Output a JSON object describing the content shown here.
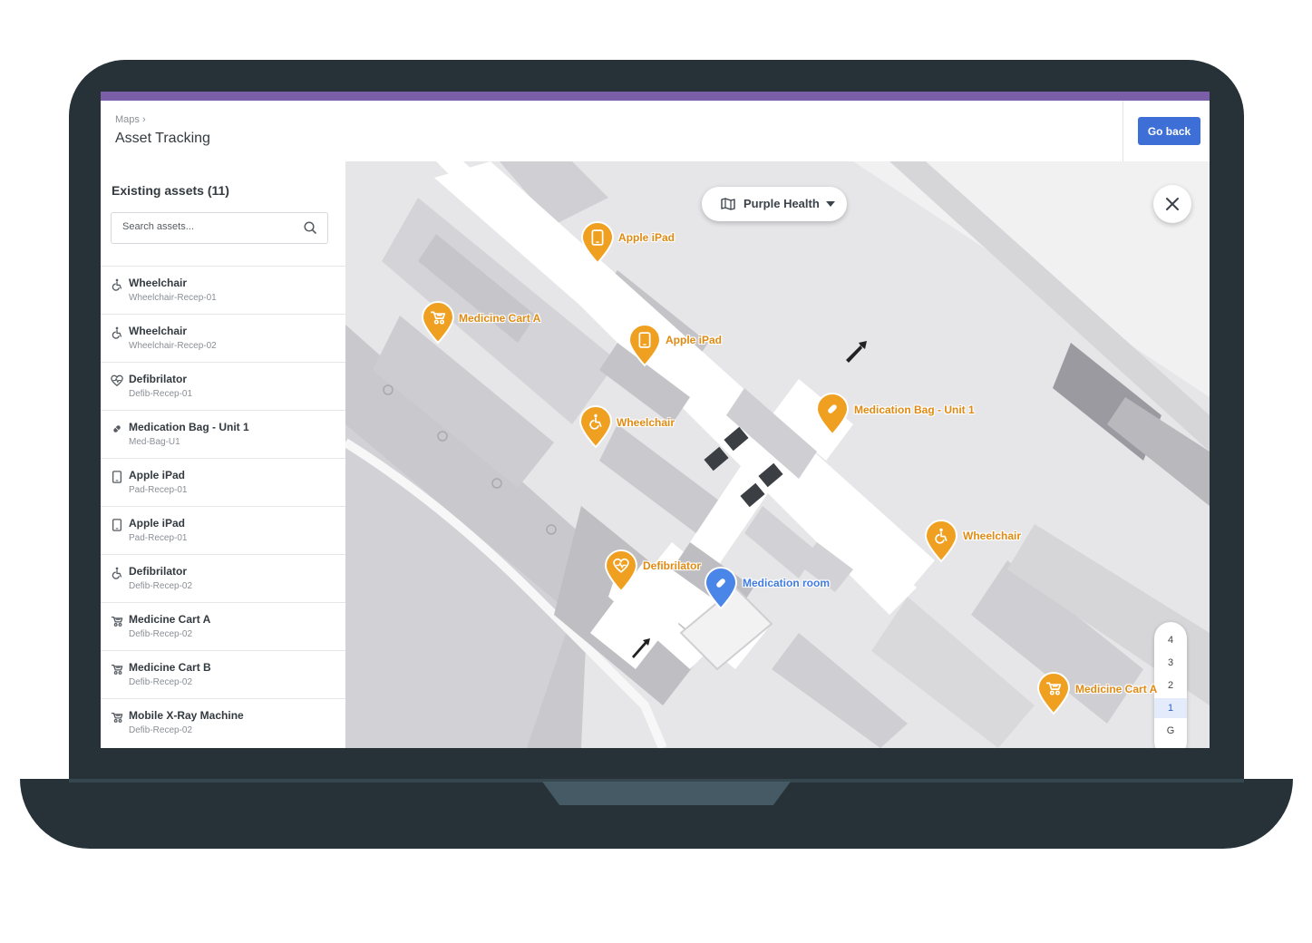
{
  "header": {
    "breadcrumb": "Maps ›",
    "title": "Asset Tracking",
    "go_back_label": "Go back"
  },
  "sidebar": {
    "heading": "Existing assets (11)",
    "search_placeholder": "Search assets...",
    "assets": [
      {
        "name": "Wheelchair",
        "id": "Wheelchair-Recep-01",
        "icon": "wheelchair-icon"
      },
      {
        "name": "Wheelchair",
        "id": "Wheelchair-Recep-02",
        "icon": "wheelchair-icon"
      },
      {
        "name": "Defibrilator",
        "id": "Defib-Recep-01",
        "icon": "heart-pulse-icon"
      },
      {
        "name": "Medication Bag - Unit 1",
        "id": "Med-Bag-U1",
        "icon": "pill-icon"
      },
      {
        "name": "Apple iPad",
        "id": "Pad-Recep-01",
        "icon": "tablet-icon"
      },
      {
        "name": "Apple iPad",
        "id": "Pad-Recep-01",
        "icon": "tablet-icon"
      },
      {
        "name": "Defibrilator",
        "id": "Defib-Recep-02",
        "icon": "wheelchair-icon"
      },
      {
        "name": "Medicine Cart A",
        "id": "Defib-Recep-02",
        "icon": "cart-icon"
      },
      {
        "name": "Medicine Cart B",
        "id": "Defib-Recep-02",
        "icon": "cart-icon"
      },
      {
        "name": "Mobile X-Ray Machine",
        "id": "Defib-Recep-02",
        "icon": "cart-icon"
      }
    ]
  },
  "map": {
    "venue": "Purple Health",
    "floors": [
      "4",
      "3",
      "2",
      "1",
      "G"
    ],
    "active_floor": "1",
    "markers": [
      {
        "label": "Apple iPad",
        "icon": "tablet-icon"
      },
      {
        "label": "Medicine Cart A",
        "icon": "cart-icon"
      },
      {
        "label": "Apple iPad",
        "icon": "tablet-icon"
      },
      {
        "label": "Wheelchair",
        "icon": "wheelchair-icon"
      },
      {
        "label": "Medication Bag - Unit 1",
        "icon": "pill-icon"
      },
      {
        "label": "Wheelchair",
        "icon": "wheelchair-icon"
      },
      {
        "label": "Defibrilator",
        "icon": "heart-pulse-icon"
      },
      {
        "label": "Medication room",
        "icon": "pill-icon"
      },
      {
        "label": "Medicine Cart A",
        "icon": "cart-icon"
      }
    ]
  },
  "colors": {
    "accent": "#7b5ea8",
    "primary_button": "#3e6fd6",
    "asset_marker": "#f0a020",
    "room_marker": "#4a86e8"
  }
}
